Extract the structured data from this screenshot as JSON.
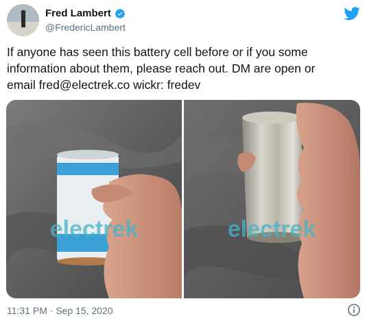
{
  "author": {
    "name": "Fred Lambert",
    "handle": "@FredericLambert",
    "verified": true
  },
  "icons": {
    "brand": "twitter-bird-icon",
    "verified": "verified-badge-icon",
    "info": "info-icon"
  },
  "tweet": {
    "lines": [
      "If anyone has seen this battery cell before or if you some",
      "information about them, please reach out. DM are open or",
      "email fred@electrek.co wickr: fredev"
    ]
  },
  "media": {
    "watermark": "electrek"
  },
  "footer": {
    "timestamp": "11:31 PM · Sep 15, 2020"
  },
  "colors": {
    "twitter_blue": "#1da1f2",
    "secondary_text": "#5b7083",
    "cell_wrap_blue": "#3aa0d6",
    "watermark": "#46b3c7"
  }
}
